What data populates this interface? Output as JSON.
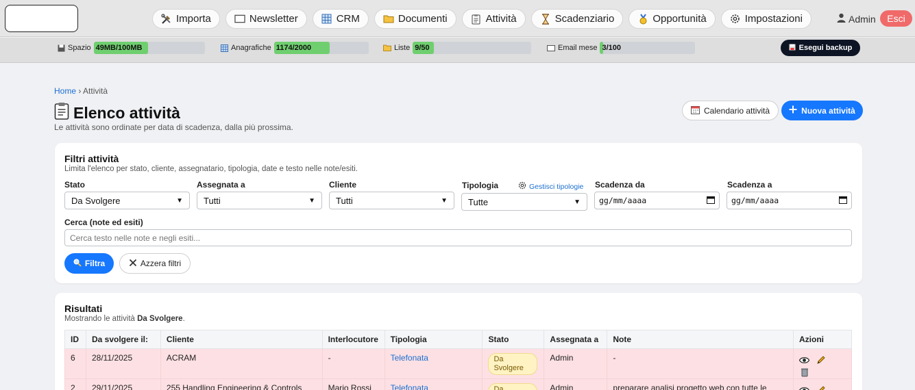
{
  "nav": {
    "items": [
      {
        "label": "Importa",
        "icon": "tools-icon"
      },
      {
        "label": "Newsletter",
        "icon": "envelope-icon"
      },
      {
        "label": "CRM",
        "icon": "grid-icon"
      },
      {
        "label": "Documenti",
        "icon": "folder-icon"
      },
      {
        "label": "Attività",
        "icon": "clipboard-icon"
      },
      {
        "label": "Scadenziario",
        "icon": "hourglass-icon"
      },
      {
        "label": "Opportunità",
        "icon": "medal-icon"
      },
      {
        "label": "Impostazioni",
        "icon": "gear-icon"
      }
    ],
    "user": "Admin",
    "logout": "Esci"
  },
  "quota": {
    "items": [
      {
        "label": "Spazio",
        "value": "49MB/100MB",
        "fraction": 0.49
      },
      {
        "label": "Anagrafiche",
        "value": "1174/2000",
        "fraction": 0.587
      },
      {
        "label": "Liste",
        "value": "9/50",
        "fraction": 0.18
      },
      {
        "label": "Email mese",
        "value": "3/100",
        "fraction": 0.03
      }
    ],
    "backup": "Esegui backup"
  },
  "page": {
    "breadcrumb_home": "Home",
    "breadcrumb_sep": "›",
    "breadcrumb_current": "Attività",
    "title": "Elenco attività",
    "subtitle": "Le attività sono ordinate per data di scadenza, dalla più prossima.",
    "calendar_button": "Calendario attività",
    "new_button": "Nuova attività"
  },
  "filters": {
    "title": "Filtri attività",
    "subtitle": "Limita l'elenco per stato, cliente, assegnatario, tipologia, date e testo nelle note/esiti.",
    "stato_label": "Stato",
    "stato_value": "Da Svolgere",
    "assegnata_label": "Assegnata a",
    "assegnata_value": "Tutti",
    "cliente_label": "Cliente",
    "cliente_value": "Tutti",
    "tipologia_label": "Tipologia",
    "tipologia_value": "Tutte",
    "manage_types": "Gestisci tipologie",
    "scad_da_label": "Scadenza da",
    "scad_da_value": "gg/mm/aaaa",
    "scad_a_label": "Scadenza a",
    "scad_a_value": "gg/mm/aaaa",
    "search_label": "Cerca (note ed esiti)",
    "search_placeholder": "Cerca testo nelle note e negli esiti...",
    "filter_button": "Filtra",
    "reset_button": "Azzera filtri"
  },
  "results": {
    "title": "Risultati",
    "subtitle_prefix": "Mostrando le attività ",
    "subtitle_state": "Da Svolgere",
    "subtitle_suffix": ".",
    "columns": [
      "ID",
      "Da svolgere il:",
      "Cliente",
      "Interlocutore",
      "Tipologia",
      "Stato",
      "Assegnata a",
      "Note",
      "Azioni"
    ],
    "rows": [
      {
        "id": "6",
        "date": "28/11/2025",
        "client": "ACRAM",
        "contact": "-",
        "type": "Telefonata",
        "state": "Da Svolgere",
        "assigned": "Admin",
        "notes": "-"
      },
      {
        "id": "2",
        "date": "29/11/2025",
        "client": "255 Handling Engineering & Controls",
        "contact": "Mario Rossi",
        "type": "Telefonata",
        "state": "Da Svolgere",
        "assigned": "Admin",
        "notes": "preparare analisi progetto web con tutte le"
      }
    ]
  }
}
